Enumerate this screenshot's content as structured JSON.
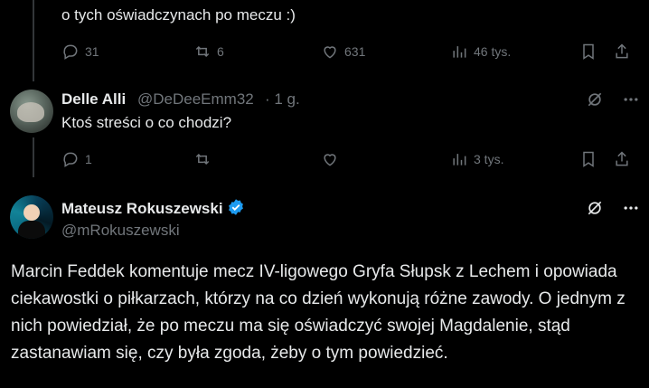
{
  "tweet1": {
    "text": "o tych oświadczynach po meczu :)",
    "replies": "31",
    "retweets": "6",
    "likes": "631",
    "views": "46 tys."
  },
  "tweet2": {
    "name": "Delle Alli",
    "handle": "@DeDeeEmm32",
    "time": "· 1 g.",
    "text": "Ktoś streści o co chodzi?",
    "replies": "1",
    "views": "3 tys."
  },
  "tweet3": {
    "name": "Mateusz Rokuszewski",
    "handle": "@mRokuszewski",
    "body": "Marcin Feddek komentuje mecz IV-ligowego Gryfa Słupsk z Lechem i opowiada ciekawostki o piłkarzach, którzy na co dzień wykonują różne zawody. O jednym z nich powiedział, że po meczu ma się oświadczyć swojej Magdalenie, stąd zastanawiam się, czy była zgoda, żeby o tym powiedzieć."
  },
  "colors": {
    "background": "#000000",
    "text": "#e7e9ea",
    "muted": "#71767b",
    "verified": "#1d9bf0",
    "divider": "#2f3336"
  }
}
